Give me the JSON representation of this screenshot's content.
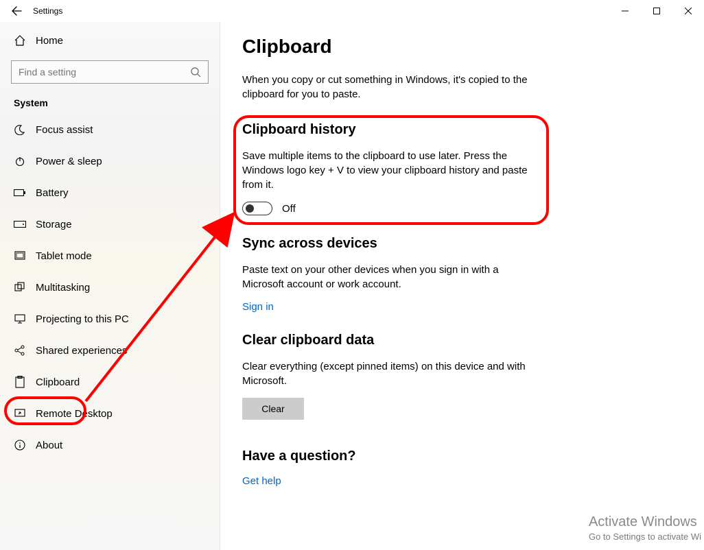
{
  "app": {
    "title": "Settings"
  },
  "sidebar": {
    "home_label": "Home",
    "search_placeholder": "Find a setting",
    "category_label": "System",
    "items": [
      {
        "id": "focus-assist",
        "label": "Focus assist"
      },
      {
        "id": "power-sleep",
        "label": "Power & sleep"
      },
      {
        "id": "battery",
        "label": "Battery"
      },
      {
        "id": "storage",
        "label": "Storage"
      },
      {
        "id": "tablet-mode",
        "label": "Tablet mode"
      },
      {
        "id": "multitasking",
        "label": "Multitasking"
      },
      {
        "id": "projecting",
        "label": "Projecting to this PC"
      },
      {
        "id": "shared-experiences",
        "label": "Shared experiences"
      },
      {
        "id": "clipboard",
        "label": "Clipboard",
        "selected": true
      },
      {
        "id": "remote-desktop",
        "label": "Remote Desktop"
      },
      {
        "id": "about",
        "label": "About"
      }
    ]
  },
  "page": {
    "title": "Clipboard",
    "intro": "When you copy or cut something in Windows, it's copied to the clipboard for you to paste.",
    "sections": {
      "history": {
        "title": "Clipboard history",
        "desc": "Save multiple items to the clipboard to use later. Press the Windows logo key + V to view your clipboard history and paste from it.",
        "toggle_state": "Off"
      },
      "sync": {
        "title": "Sync across devices",
        "desc": "Paste text on your other devices when you sign in with a Microsoft account or work account.",
        "link": "Sign in"
      },
      "clear": {
        "title": "Clear clipboard data",
        "desc": "Clear everything (except pinned items) on this device and with Microsoft.",
        "button": "Clear"
      },
      "help": {
        "title": "Have a question?",
        "link": "Get help"
      }
    }
  },
  "watermark": {
    "line1": "Activate Windows",
    "line2": "Go to Settings to activate Wi"
  }
}
